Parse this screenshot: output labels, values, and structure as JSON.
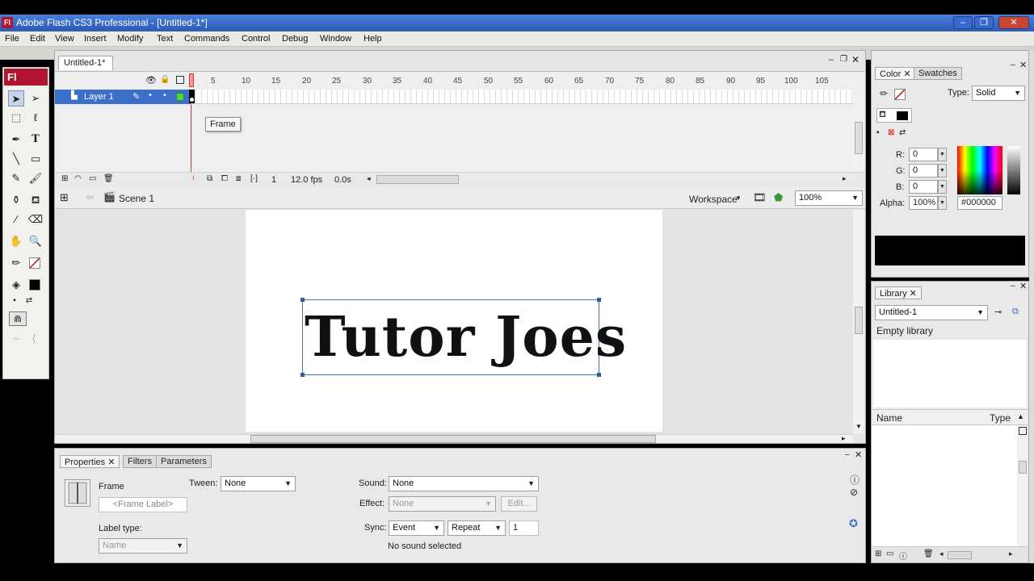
{
  "window": {
    "title": "Adobe Flash CS3 Professional - [Untitled-1*]",
    "app_badge": "Fl",
    "min_glyph": "–",
    "max_glyph": "❐",
    "close_glyph": "✕"
  },
  "menu": [
    "File",
    "Edit",
    "View",
    "Insert",
    "Modify",
    "Text",
    "Commands",
    "Control",
    "Debug",
    "Window",
    "Help"
  ],
  "toolbox": {
    "header": "Fl"
  },
  "document": {
    "tab_label": "Untitled-1*",
    "layer_name": "Layer 1",
    "ruler": [
      "5",
      "10",
      "15",
      "20",
      "25",
      "30",
      "35",
      "40",
      "45",
      "50",
      "55",
      "60",
      "65",
      "70",
      "75",
      "80",
      "85",
      "90",
      "95",
      "100",
      "105"
    ],
    "tooltip": "Frame",
    "status": {
      "current_frame": "1",
      "fps": "12.0 fps",
      "time": "0.0s"
    },
    "scene": "Scene 1",
    "workspace": "Workspace",
    "zoom": "100%",
    "stage_text": "Tutor Joes"
  },
  "properties": {
    "tabs": [
      "Properties",
      "Filters",
      "Parameters"
    ],
    "frame_label": "Frame",
    "frame_label_placeholder": "<Frame Label>",
    "tween_label": "Tween:",
    "tween_value": "None",
    "label_type_label": "Label type:",
    "label_type_value": "Name",
    "sound_label": "Sound:",
    "sound_value": "None",
    "effect_label": "Effect:",
    "effect_value": "None",
    "edit_button": "Edit...",
    "sync_label": "Sync:",
    "sync_value": "Event",
    "repeat_value": "Repeat",
    "repeat_count": "1",
    "status_text": "No sound selected"
  },
  "color_panel": {
    "tabs": [
      "Color",
      "Swatches"
    ],
    "type_label": "Type:",
    "type_value": "Solid",
    "r_label": "R:",
    "r_value": "0",
    "g_label": "G:",
    "g_value": "0",
    "b_label": "B:",
    "b_value": "0",
    "alpha_label": "Alpha:",
    "alpha_value": "100%",
    "hex_value": "#000000",
    "fill_color": "#000000"
  },
  "library_panel": {
    "tab": "Library",
    "document_select": "Untitled-1",
    "empty_text": "Empty library",
    "col_name": "Name",
    "col_type": "Type"
  }
}
